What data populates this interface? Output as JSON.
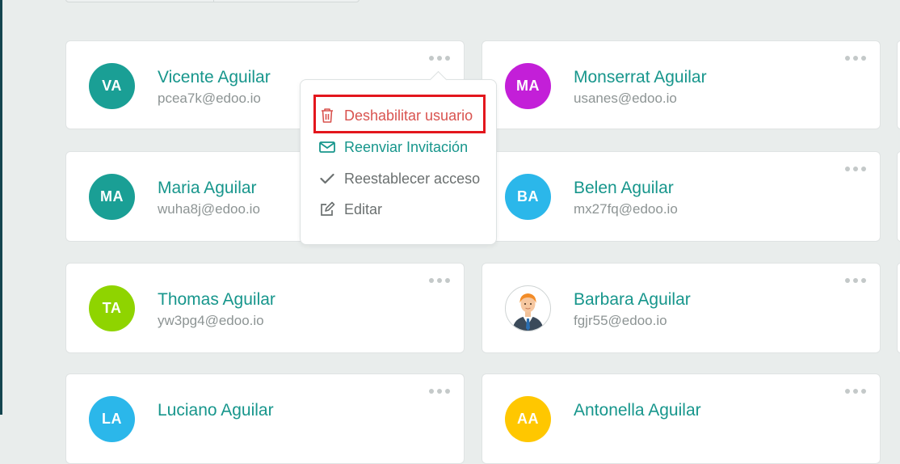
{
  "users": [
    {
      "initials": "VA",
      "name": "Vicente Aguilar",
      "email": "pcea7k@edoo.io",
      "color": "#1a9f95"
    },
    {
      "initials": "MA",
      "name": "Monserrat Aguilar",
      "email": "usanes@edoo.io",
      "color": "#c31fd8"
    },
    {
      "initials": "MA",
      "name": "Maria Aguilar",
      "email": "wuha8j@edoo.io",
      "color": "#1a9f95"
    },
    {
      "initials": "BA",
      "name": "Belen Aguilar",
      "email": "mx27fq@edoo.io",
      "color": "#2bb7ea"
    },
    {
      "initials": "TA",
      "name": "Thomas Aguilar",
      "email": "yw3pg4@edoo.io",
      "color": "#8fd400"
    },
    {
      "initials": "",
      "name": "Barbara Aguilar",
      "email": "fgjr55@edoo.io",
      "color": "#ffffff"
    },
    {
      "initials": "LA",
      "name": "Luciano Aguilar",
      "email": "",
      "color": "#2bb7ea"
    },
    {
      "initials": "AA",
      "name": "Antonella Aguilar",
      "email": "",
      "color": "#ffc700"
    }
  ],
  "menu": {
    "items": [
      {
        "label": "Deshabilitar usuario",
        "icon": "trash-icon",
        "color": "#d9534f"
      },
      {
        "label": "Reenviar Invitación",
        "icon": "envelope-icon",
        "color": "#17968c"
      },
      {
        "label": "Reestablecer acceso",
        "icon": "check-icon",
        "color": "#6b7070"
      },
      {
        "label": "Editar",
        "icon": "edit-icon",
        "color": "#6b7070"
      }
    ]
  }
}
